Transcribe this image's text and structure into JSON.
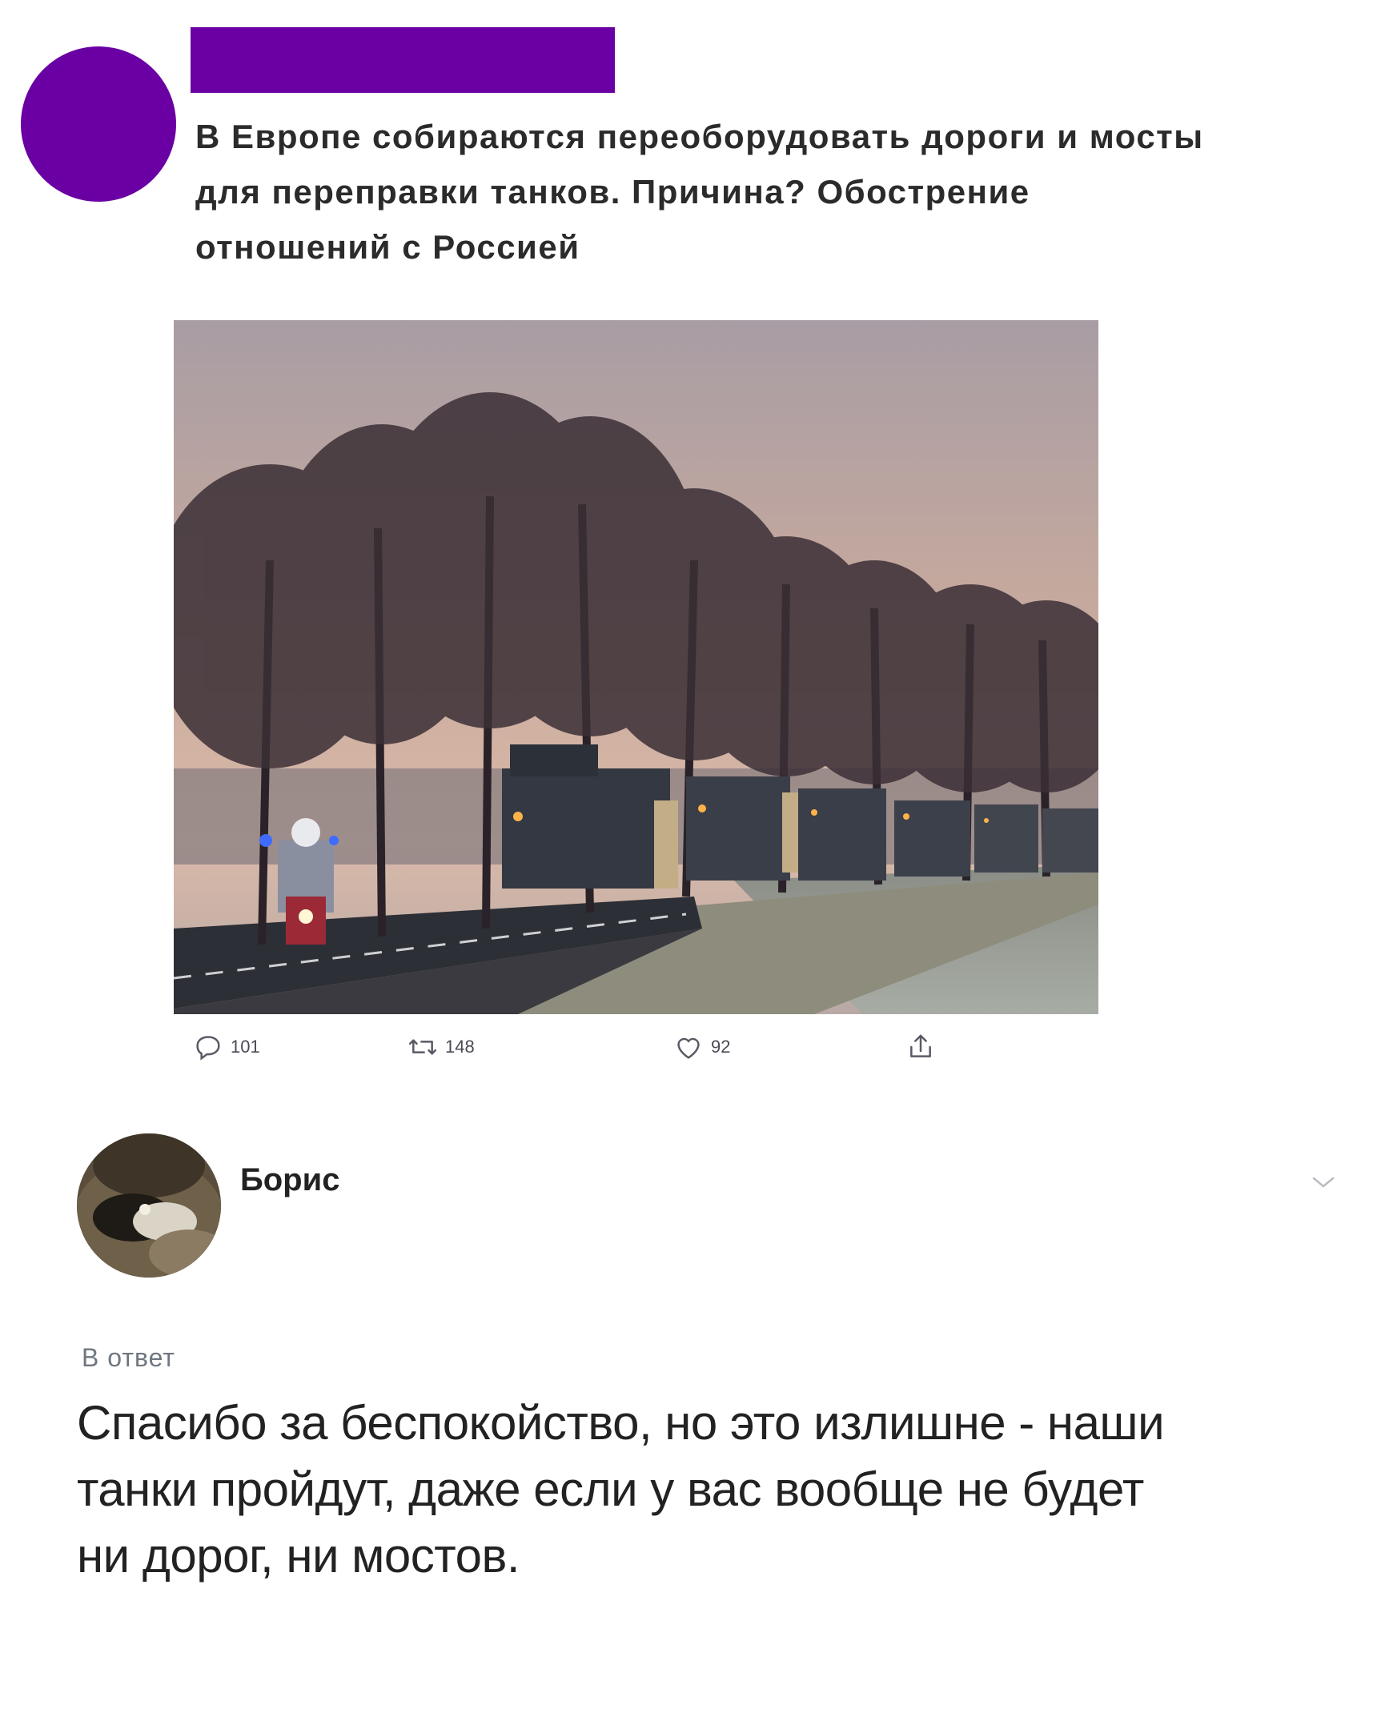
{
  "tweet": {
    "text_lines": [
      "В Европе собираются переоборудовать дороги и мосты",
      "для переправки танков. Причина? Обострение",
      "отношений с Россией"
    ],
    "photo_icon": "military-convoy-photo",
    "actions": {
      "reply": {
        "icon": "reply-icon",
        "count": "101"
      },
      "retweet": {
        "icon": "retweet-icon",
        "count": "148"
      },
      "like": {
        "icon": "heart-icon",
        "count": "92"
      },
      "share": {
        "icon": "share-icon"
      }
    },
    "accent_color": "#6a00a3"
  },
  "reply": {
    "author_name": "Борис",
    "replying_to": "В ответ",
    "text_lines": [
      "Спасибо за беспокойство, но это излишне - наши",
      "танки пройдут, даже если у вас вообще не будет",
      "ни дорог, ни мостов."
    ],
    "menu_icon": "chevron-down-icon"
  }
}
